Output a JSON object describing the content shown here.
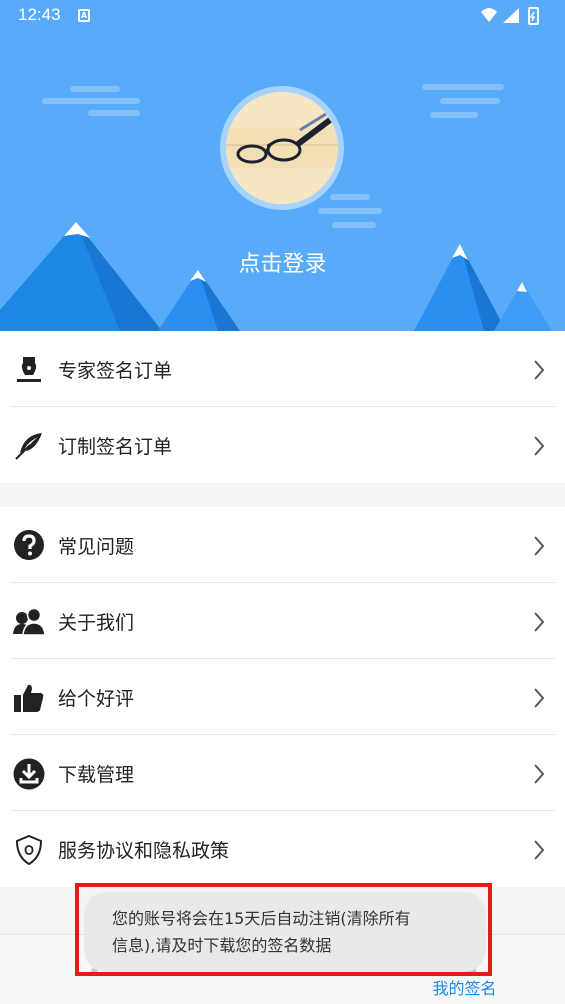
{
  "status_bar": {
    "time": "12:43",
    "notification_icon": "A"
  },
  "header": {
    "login_label": "点击登录",
    "colors": {
      "sky": "#58abf8",
      "mountain": "#1e88e5",
      "snow": "#ffffff"
    }
  },
  "menu_group_1": {
    "items": [
      {
        "label": "专家签名订单",
        "icon": "pen-nib-icon"
      },
      {
        "label": "订制签名订单",
        "icon": "feather-icon"
      }
    ]
  },
  "menu_group_2": {
    "items": [
      {
        "label": "常见问题",
        "icon": "question-icon"
      },
      {
        "label": "关于我们",
        "icon": "users-icon"
      },
      {
        "label": "给个好评",
        "icon": "thumbs-up-icon"
      },
      {
        "label": "下载管理",
        "icon": "download-icon"
      },
      {
        "label": "服务协议和隐私政策",
        "icon": "shield-icon"
      }
    ]
  },
  "tabbar": {
    "tabs": [
      {
        "label": "",
        "icon": "pen-icon"
      },
      {
        "label": "",
        "icon": "nib-icon"
      },
      {
        "label": "",
        "icon": "feather-icon"
      },
      {
        "label": "我的签名",
        "icon": "user-icon",
        "active": true
      }
    ]
  },
  "toast": {
    "line1": "您的账号将会在15天后自动注销(清除所有",
    "line2": "信息),请及时下载您的签名数据"
  }
}
